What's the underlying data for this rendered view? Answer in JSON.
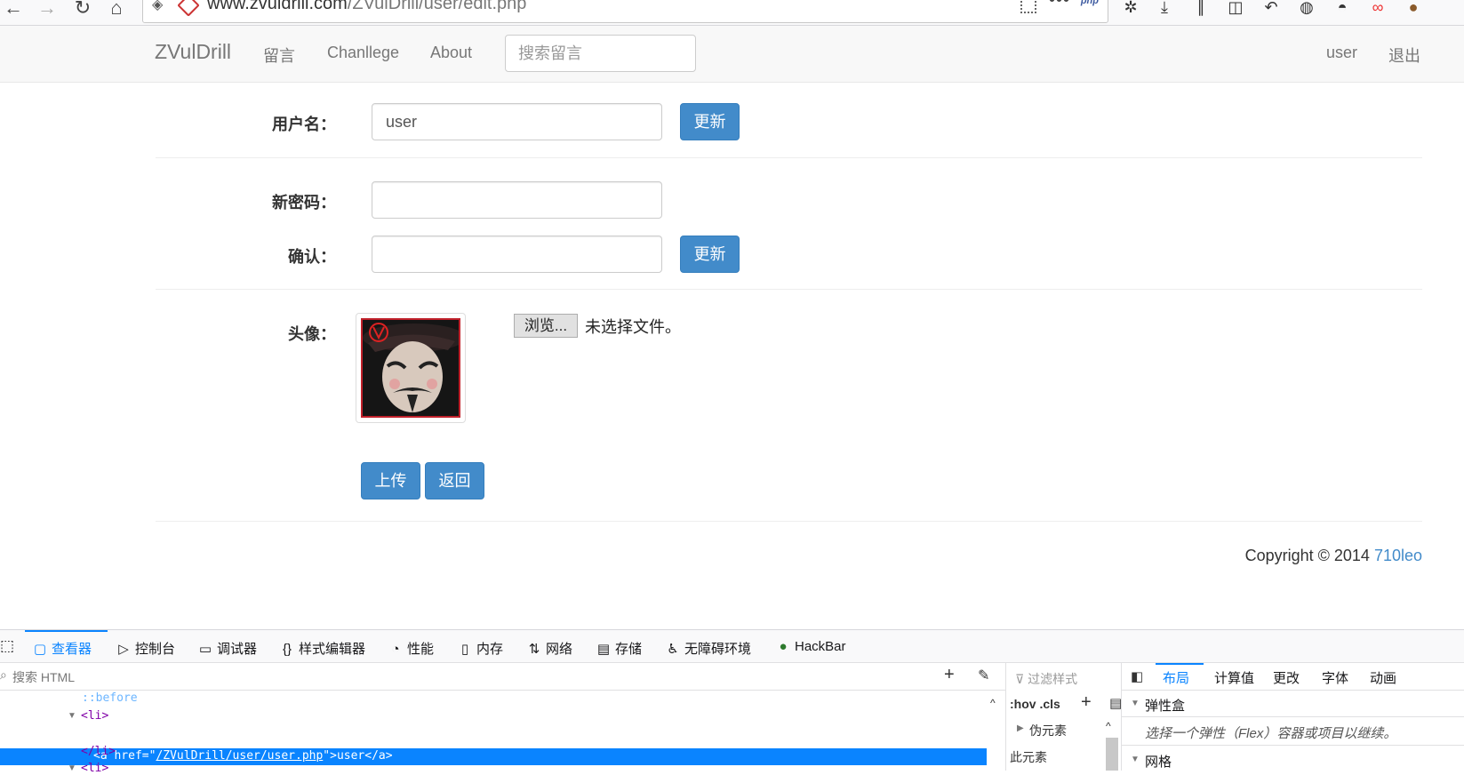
{
  "browser": {
    "url_host": "www.zvuldrill.com",
    "url_path": "/ZVulDrill/user/edit.php",
    "php_badge": "php"
  },
  "navbar": {
    "brand": "ZVulDrill",
    "links": [
      "留言",
      "Chanllege",
      "About"
    ],
    "search_placeholder": "搜索留言",
    "user": "user",
    "logout": "退出"
  },
  "form": {
    "username_label": "用户名：",
    "username_value": "user",
    "update_label": "更新",
    "new_password_label": "新密码：",
    "confirm_label": "确认：",
    "avatar_label": "头像：",
    "browse_label": "浏览...",
    "no_file_text": "未选择文件。",
    "upload_label": "上传",
    "back_label": "返回"
  },
  "footer": {
    "copyright": "Copyright © 2014 ",
    "author": "710leo"
  },
  "devtools": {
    "tabs": [
      "查看器",
      "控制台",
      "调试器",
      "样式编辑器",
      "性能",
      "内存",
      "网络",
      "存储",
      "无障碍环境",
      "HackBar"
    ],
    "search_placeholder": "搜索 HTML",
    "code_lines": [
      "::before",
      "<li>",
      "</li>",
      "<li>"
    ],
    "selected_prefix": "<a href=\"",
    "selected_href": "/ZVulDrill/user/user.php",
    "selected_suffix": "\">user</a>",
    "filter_placeholder": "过滤样式",
    "hov_cls": ":hov .cls",
    "pseudo_elements": "伪元素",
    "this_element": "此元素",
    "layout_tabs": [
      "布局",
      "计算值",
      "更改",
      "字体",
      "动画"
    ],
    "flexbox_header": "弹性盒",
    "flexbox_hint": "选择一个弹性（Flex）容器或项目以继续。",
    "grid_header": "网格"
  },
  "colors": {
    "primary": "#428bca",
    "devtools_accent": "#0a84ff"
  }
}
